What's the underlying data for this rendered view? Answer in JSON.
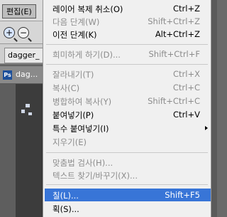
{
  "menubar": {
    "edit_label": "편집(E)"
  },
  "toolbar": {
    "zoom_in_symbol": "+",
    "zoom_out_symbol": "−"
  },
  "tabs": {
    "tab1_label": "dagger_"
  },
  "document": {
    "badge": "Ps",
    "title": "dag..."
  },
  "menu": {
    "items": [
      {
        "label": "레이어 복제 취소(O)",
        "shortcut": "Ctrl+Z",
        "disabled": false
      },
      {
        "label": "다음 단계(W)",
        "shortcut": "Shift+Ctrl+Z",
        "disabled": true
      },
      {
        "label": "이전 단계(K)",
        "shortcut": "Alt+Ctrl+Z",
        "disabled": false
      },
      {
        "label": "희미하게 하기(D)...",
        "shortcut": "Shift+Ctrl+F",
        "disabled": true
      },
      {
        "label": "잘라내기(T)",
        "shortcut": "Ctrl+X",
        "disabled": true
      },
      {
        "label": "복사(C)",
        "shortcut": "Ctrl+C",
        "disabled": true
      },
      {
        "label": "병합하여 복사(Y)",
        "shortcut": "Shift+Ctrl+C",
        "disabled": true
      },
      {
        "label": "붙여넣기(P)",
        "shortcut": "Ctrl+V",
        "disabled": false
      },
      {
        "label": "특수 붙여넣기(I)",
        "shortcut": "",
        "disabled": false,
        "submenu": true
      },
      {
        "label": "지우기(E)",
        "shortcut": "",
        "disabled": true
      },
      {
        "label": "맞춤법 검사(H)...",
        "shortcut": "",
        "disabled": true
      },
      {
        "label": "텍스트 찾기/바꾸기(X)...",
        "shortcut": "",
        "disabled": true
      },
      {
        "label": "칠(L)...",
        "shortcut": "Shift+F5",
        "disabled": false,
        "highlighted": true
      },
      {
        "label": "획(S)...",
        "shortcut": "",
        "disabled": false
      }
    ]
  }
}
